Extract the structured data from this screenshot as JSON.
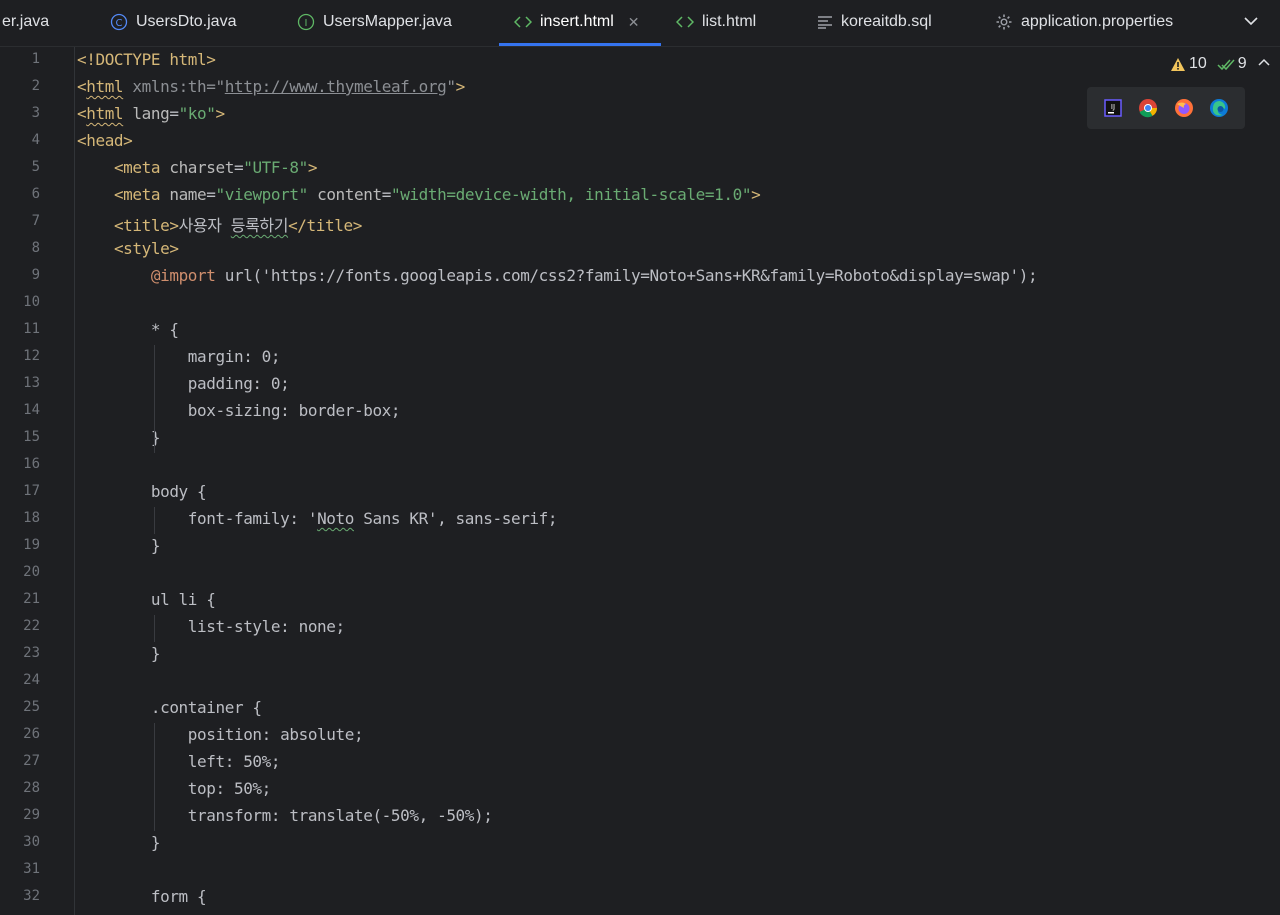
{
  "tabs": [
    {
      "label": "er.java",
      "icon": "none",
      "active": false
    },
    {
      "label": "UsersDto.java",
      "icon": "class-icon",
      "active": false
    },
    {
      "label": "UsersMapper.java",
      "icon": "interface-icon",
      "active": false
    },
    {
      "label": "insert.html",
      "icon": "html-icon",
      "active": true
    },
    {
      "label": "list.html",
      "icon": "html-icon",
      "active": false
    },
    {
      "label": "koreaitdb.sql",
      "icon": "sql-icon",
      "active": false
    },
    {
      "label": "application.properties",
      "icon": "gear-icon",
      "active": false
    }
  ],
  "inspections": {
    "warnings": "10",
    "ok": "9"
  },
  "browsers": [
    "intellij-browser-icon",
    "chrome-icon",
    "firefox-icon",
    "edge-icon"
  ],
  "colors": {
    "accent": "#3574f0",
    "tag": "#d5b778",
    "string": "#6aab73",
    "keyword": "#cf8e6d",
    "text": "#bcbec4"
  },
  "lines": [
    {
      "n": "1",
      "segs": [
        [
          "tag",
          "<!DOCTYPE html>"
        ]
      ]
    },
    {
      "n": "2",
      "segs": [
        [
          "tag",
          "<"
        ],
        [
          "tag-w",
          "html"
        ],
        [
          "txt",
          " "
        ],
        [
          "dim",
          "xmlns:th"
        ],
        [
          "dim",
          "="
        ],
        [
          "dim",
          "\""
        ],
        [
          "url",
          "http://www.thymeleaf.org"
        ],
        [
          "dim",
          "\""
        ],
        [
          "tag",
          ">"
        ]
      ]
    },
    {
      "n": "3",
      "segs": [
        [
          "tag",
          "<"
        ],
        [
          "tag-w",
          "html"
        ],
        [
          "txt",
          " "
        ],
        [
          "attr",
          "lang"
        ],
        [
          "txt",
          "="
        ],
        [
          "str",
          "\"ko\""
        ],
        [
          "tag",
          ">"
        ]
      ]
    },
    {
      "n": "4",
      "segs": [
        [
          "tag",
          "<head>"
        ]
      ]
    },
    {
      "n": "5",
      "segs": [
        [
          "txt",
          "    "
        ],
        [
          "tag",
          "<meta"
        ],
        [
          "txt",
          " "
        ],
        [
          "attr",
          "charset"
        ],
        [
          "txt",
          "="
        ],
        [
          "str",
          "\"UTF-8\""
        ],
        [
          "tag",
          ">"
        ]
      ]
    },
    {
      "n": "6",
      "segs": [
        [
          "txt",
          "    "
        ],
        [
          "tag",
          "<meta"
        ],
        [
          "txt",
          " "
        ],
        [
          "attr",
          "name"
        ],
        [
          "txt",
          "="
        ],
        [
          "str",
          "\"viewport\""
        ],
        [
          "txt",
          " "
        ],
        [
          "attr",
          "content"
        ],
        [
          "txt",
          "="
        ],
        [
          "str",
          "\"width=device-width, initial-scale=1.0\""
        ],
        [
          "tag",
          ">"
        ]
      ]
    },
    {
      "n": "7",
      "segs": [
        [
          "txt",
          "    "
        ],
        [
          "tag",
          "<title>"
        ],
        [
          "txt",
          "사용자 "
        ],
        [
          "txt-w",
          "등록하기"
        ],
        [
          "tag",
          "</title>"
        ]
      ]
    },
    {
      "n": "8",
      "segs": [
        [
          "txt",
          "    "
        ],
        [
          "tag",
          "<style>"
        ]
      ]
    },
    {
      "n": "9",
      "segs": [
        [
          "txt",
          "        "
        ],
        [
          "kw",
          "@import"
        ],
        [
          "txt",
          " url('https://fonts.googleapis.com/css2?family=Noto+Sans+KR&family=Roboto&display=swap');"
        ]
      ]
    },
    {
      "n": "10",
      "segs": []
    },
    {
      "n": "11",
      "segs": [
        [
          "txt",
          "        * {"
        ]
      ]
    },
    {
      "n": "12",
      "segs": [
        [
          "txt",
          "            margin: 0;"
        ]
      ]
    },
    {
      "n": "13",
      "segs": [
        [
          "txt",
          "            padding: 0;"
        ]
      ]
    },
    {
      "n": "14",
      "segs": [
        [
          "txt",
          "            box-sizing: border-box;"
        ]
      ]
    },
    {
      "n": "15",
      "segs": [
        [
          "txt",
          "        }"
        ]
      ]
    },
    {
      "n": "16",
      "segs": []
    },
    {
      "n": "17",
      "segs": [
        [
          "txt",
          "        body {"
        ]
      ]
    },
    {
      "n": "18",
      "segs": [
        [
          "txt",
          "            font-family: '"
        ],
        [
          "txt-w",
          "Noto"
        ],
        [
          "txt",
          " Sans KR', sans-serif;"
        ]
      ]
    },
    {
      "n": "19",
      "segs": [
        [
          "txt",
          "        }"
        ]
      ]
    },
    {
      "n": "20",
      "segs": []
    },
    {
      "n": "21",
      "segs": [
        [
          "txt",
          "        ul li {"
        ]
      ]
    },
    {
      "n": "22",
      "segs": [
        [
          "txt",
          "            list-style: none;"
        ]
      ]
    },
    {
      "n": "23",
      "segs": [
        [
          "txt",
          "        }"
        ]
      ]
    },
    {
      "n": "24",
      "segs": []
    },
    {
      "n": "25",
      "segs": [
        [
          "txt",
          "        .container {"
        ]
      ]
    },
    {
      "n": "26",
      "segs": [
        [
          "txt",
          "            position: absolute;"
        ]
      ]
    },
    {
      "n": "27",
      "segs": [
        [
          "txt",
          "            left: 50%;"
        ]
      ]
    },
    {
      "n": "28",
      "segs": [
        [
          "txt",
          "            top: 50%;"
        ]
      ]
    },
    {
      "n": "29",
      "segs": [
        [
          "txt",
          "            transform: translate(-50%, -50%);"
        ]
      ]
    },
    {
      "n": "30",
      "segs": [
        [
          "txt",
          "        }"
        ]
      ]
    },
    {
      "n": "31",
      "segs": []
    },
    {
      "n": "32",
      "segs": [
        [
          "txt",
          "        form {"
        ]
      ]
    }
  ]
}
